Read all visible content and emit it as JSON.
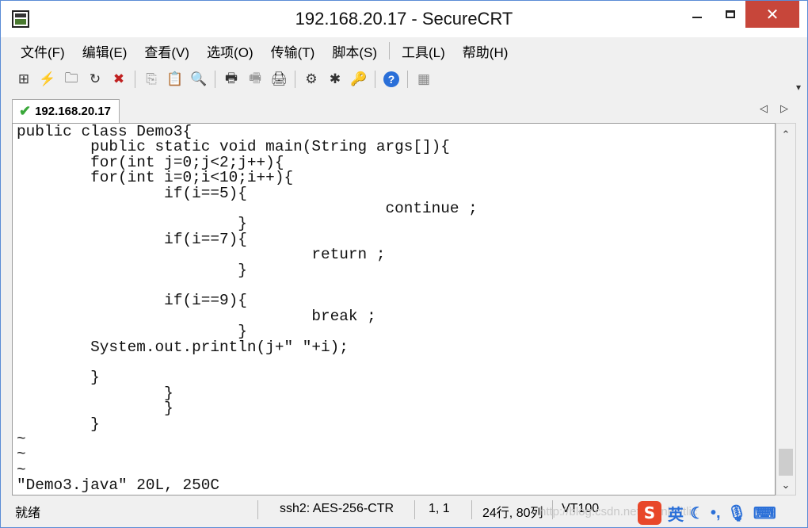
{
  "window": {
    "title": "192.168.20.17 - SecureCRT"
  },
  "titlebar": {
    "minimize": "—",
    "maximize": "☐",
    "close": "✕"
  },
  "menu": [
    "文件(F)",
    "编辑(E)",
    "查看(V)",
    "选项(O)",
    "传输(T)",
    "脚本(S)",
    "工具(L)",
    "帮助(H)"
  ],
  "toolbar": {
    "icons": [
      "connect-icon",
      "quick-connect-icon",
      "connect-tab-icon",
      "reconnect-icon",
      "disconnect-icon",
      "copy-icon",
      "paste-icon",
      "find-icon",
      "print-icon",
      "print-selection-icon",
      "print-setup-icon",
      "session-options-icon",
      "global-options-icon",
      "keymap-icon",
      "help-icon",
      "sftp-icon"
    ],
    "glyphs": [
      "⊞",
      "⚡",
      "🗀",
      "↻",
      "✖",
      "⎘",
      "📋",
      "🔍",
      "🖶",
      "🖷",
      "🖨",
      "⚙",
      "✱",
      "🔑",
      "?",
      "▦"
    ],
    "chevron": "▾"
  },
  "tab": {
    "check": "✔",
    "label": "192.168.20.17",
    "prev": "◁",
    "next": "▷"
  },
  "terminal": {
    "lines": [
      "public class Demo3{",
      "        public static void main(String args[]){",
      "        for(int j=0;j<2;j++){",
      "        for(int i=0;i<10;i++){",
      "                if(i==5){",
      "                                        continue ;",
      "                        }",
      "                if(i==7){",
      "                                return ;",
      "                        }",
      "",
      "                if(i==9){",
      "                                break ;",
      "                        }",
      "        System.out.println(j+\" \"+i);",
      "",
      "        }",
      "                }",
      "                }",
      "        }",
      "~",
      "~",
      "~",
      "\"Demo3.java\" 20L, 250C"
    ]
  },
  "scrollbar": {
    "up": "⌃",
    "down": "⌄"
  },
  "status": {
    "ready": "就绪",
    "protocol": "ssh2: AES-256-CTR",
    "cursor": "1,   1",
    "size": "24行, 80列",
    "terminal_type": "VT100"
  },
  "watermark": "http://blog.csdn.net/Frank_itlic",
  "ime": {
    "logo": "S",
    "mode": "英"
  },
  "colors": {
    "close_button": "#c7463a",
    "check": "#3aa83a",
    "ime_logo": "#e8472a"
  }
}
